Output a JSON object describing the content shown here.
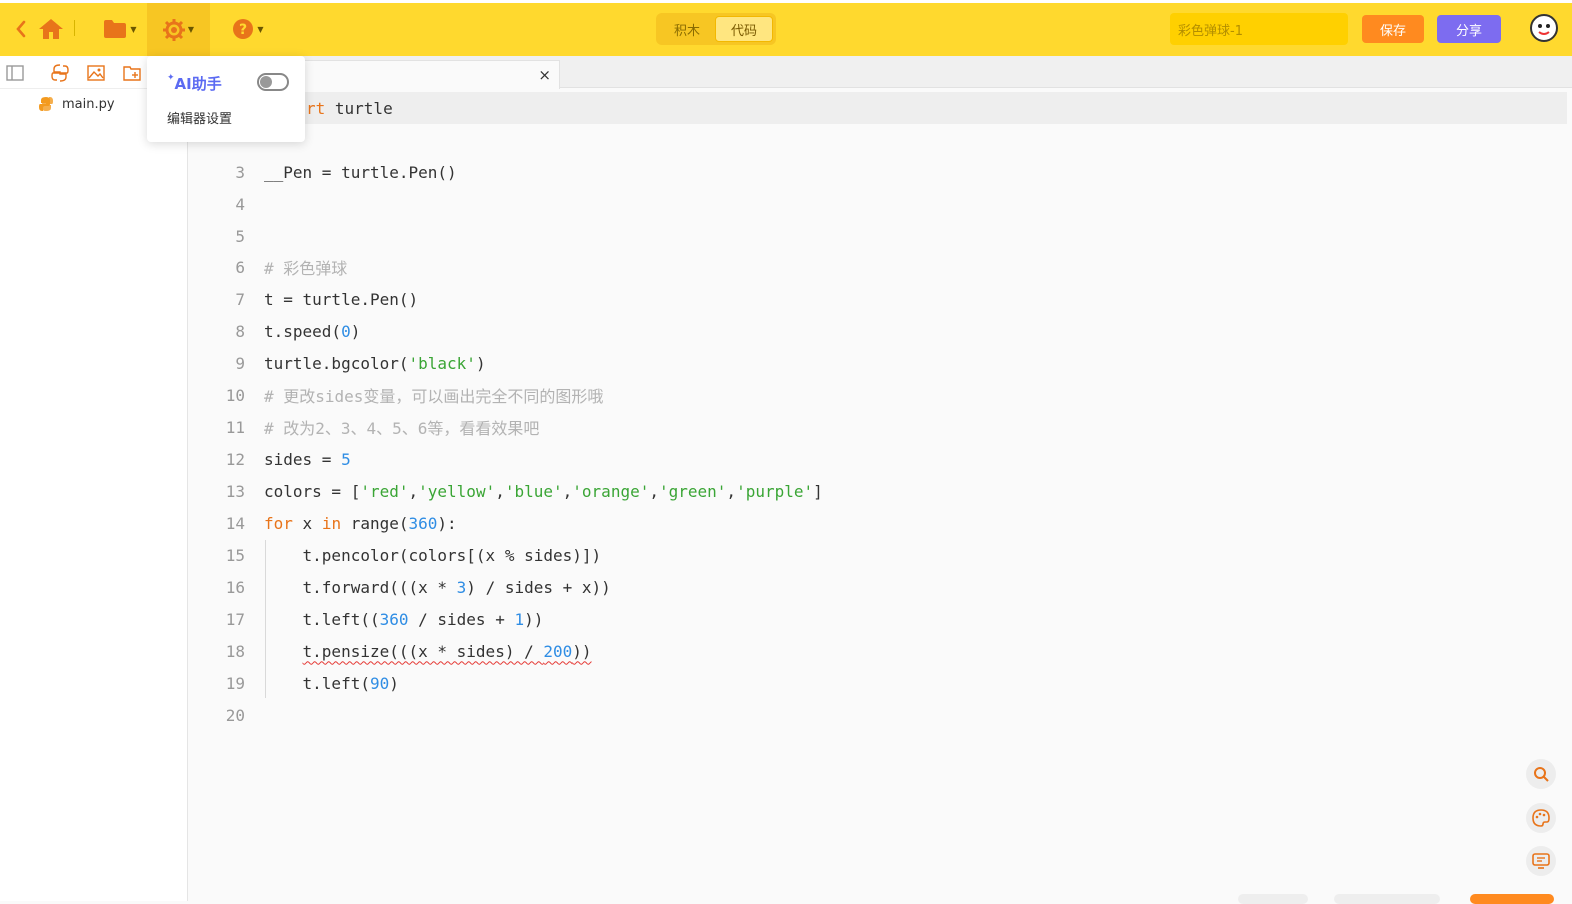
{
  "header": {
    "mode_blocks": "积木",
    "mode_code": "代码",
    "project_name": "彩色弹球-1",
    "save_label": "保存",
    "share_label": "分享"
  },
  "dropdown": {
    "ai_label": "AI助手",
    "settings_label": "编辑器设置",
    "ai_toggle_on": false
  },
  "file_tree": {
    "files": [
      "main.py"
    ]
  },
  "editor": {
    "tab_close": "×",
    "visible_line1_fragment": "rt turtle"
  },
  "colors": {
    "header_bg": "#ffd92e",
    "save": "#ff8a1f",
    "share": "#7d6cf0",
    "keyword": "#e8741a",
    "string": "#3aa535",
    "number": "#2f8de4",
    "comment": "#b3b3b3"
  },
  "icons": [
    "back-icon",
    "home-icon",
    "folder-icon",
    "gear-icon",
    "help-icon",
    "sidebar-toggle-icon",
    "python-file-icon",
    "image-icon",
    "new-folder-icon",
    "search-icon",
    "palette-icon",
    "monitor-icon"
  ],
  "code_lines": [
    {
      "n": "3",
      "text": "__Pen = turtle.Pen()"
    },
    {
      "n": "4",
      "text": ""
    },
    {
      "n": "5",
      "text": ""
    },
    {
      "n": "6",
      "text": "# 彩色弹球"
    },
    {
      "n": "7",
      "text": "t = turtle.Pen()"
    },
    {
      "n": "8",
      "text": "t.speed(0)"
    },
    {
      "n": "9",
      "text": "turtle.bgcolor('black')"
    },
    {
      "n": "10",
      "text": "# 更改sides变量，可以画出完全不同的图形哦"
    },
    {
      "n": "11",
      "text": "# 改为2、3、4、5、6等，看看效果吧"
    },
    {
      "n": "12",
      "text": "sides = 5"
    },
    {
      "n": "13",
      "text": "colors = ['red','yellow','blue','orange','green','purple']"
    },
    {
      "n": "14",
      "text": "for x in range(360):"
    },
    {
      "n": "15",
      "text": "    t.pencolor(colors[(x % sides)])"
    },
    {
      "n": "16",
      "text": "    t.forward(((x * 3) / sides + x))"
    },
    {
      "n": "17",
      "text": "    t.left((360 / sides + 1))"
    },
    {
      "n": "18",
      "text": "    t.pensize(((x * sides) / 200))"
    },
    {
      "n": "19",
      "text": "    t.left(90)"
    },
    {
      "n": "20",
      "text": ""
    }
  ]
}
